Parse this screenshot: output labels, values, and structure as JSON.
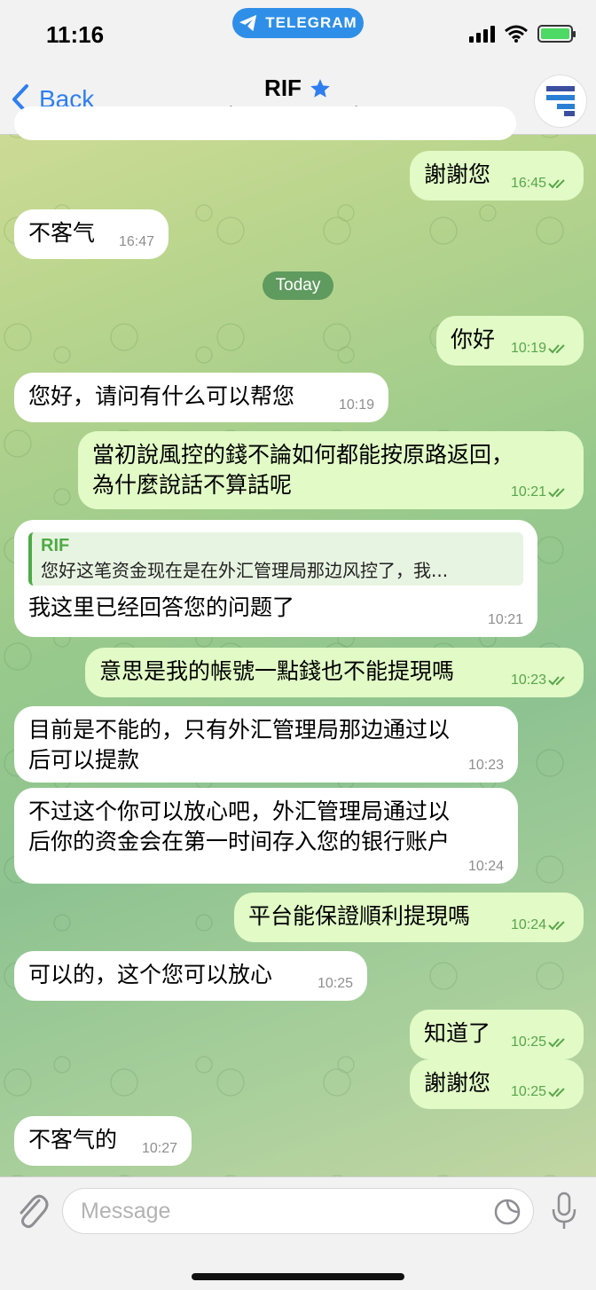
{
  "status_bar": {
    "time": "11:16",
    "app_pill": "TELEGRAM"
  },
  "header": {
    "back_label": "Back",
    "title": "RIF",
    "subtitle": "last seen recently"
  },
  "day_separator": "Today",
  "messages": [
    {
      "dir": "out",
      "text": "謝謝您",
      "time": "16:45"
    },
    {
      "dir": "in",
      "text": "不客气",
      "time": "16:47"
    },
    {
      "dir": "out",
      "text": "你好",
      "time": "10:19"
    },
    {
      "dir": "in",
      "text": "您好，请问有什么可以帮您",
      "time": "10:19"
    },
    {
      "dir": "out",
      "line1": "當初說風控的錢不論如何都能按原路返回，",
      "line2": "為什麼說話不算話呢",
      "time": "10:21"
    },
    {
      "dir": "in",
      "reply_name": "RIF",
      "reply_text": "您好这笔资金现在是在外汇管理局那边风控了，我...",
      "text": "我这里已经回答您的问题了",
      "time": "10:21"
    },
    {
      "dir": "out",
      "text": "意思是我的帳號一點錢也不能提現嗎",
      "time": "10:23"
    },
    {
      "dir": "in",
      "line1": "目前是不能的，只有外汇管理局那边通过以",
      "line2": "后可以提款",
      "time": "10:23"
    },
    {
      "dir": "in",
      "line1": "不过这个你可以放心吧，外汇管理局通过以",
      "line2": "后你的资金会在第一时间存入您的银行账户",
      "time": "10:24"
    },
    {
      "dir": "out",
      "text": "平台能保證順利提現嗎",
      "time": "10:24"
    },
    {
      "dir": "in",
      "text": "可以的，这个您可以放心",
      "time": "10:25"
    },
    {
      "dir": "out",
      "text": "知道了",
      "time": "10:25"
    },
    {
      "dir": "out",
      "text": "謝謝您",
      "time": "10:25"
    },
    {
      "dir": "in",
      "text": "不客气的",
      "time": "10:27"
    }
  ],
  "input": {
    "placeholder": "Message",
    "value": ""
  },
  "colors": {
    "accent": "#2f7ef0",
    "outgoing_bubble": "#e1fac6",
    "check_green": "#59a64c",
    "day_pill": "#5f9a5f"
  }
}
